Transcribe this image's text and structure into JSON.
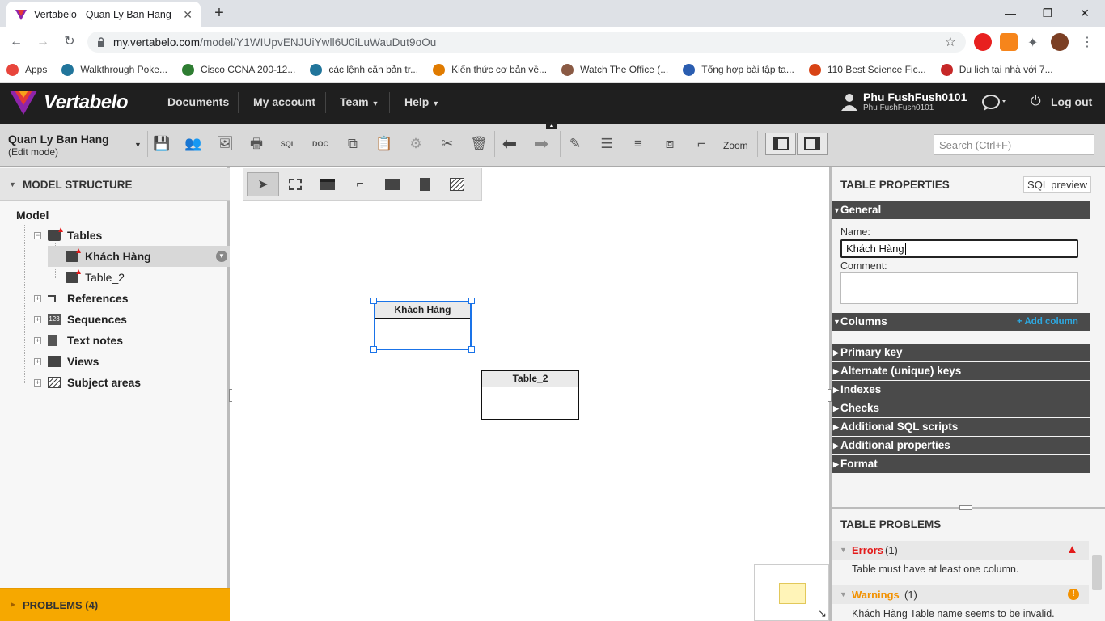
{
  "browser": {
    "tab_title": "Vertabelo - Quan Ly Ban Hang",
    "url_host": "my.vertabelo.com",
    "url_path": "/model/Y1WIUpvENJUiYwll6U0iLuWauDut9oOu",
    "bookmarks": [
      {
        "label": "Apps",
        "color": "#e8453c"
      },
      {
        "label": "Walkthrough Poke...",
        "color": "#21759b"
      },
      {
        "label": "Cisco CCNA 200-12...",
        "color": "#2e7d32"
      },
      {
        "label": "các lệnh căn bản tr...",
        "color": "#21759b"
      },
      {
        "label": "Kiến thức cơ bản về...",
        "color": "#e07b00"
      },
      {
        "label": "Watch The Office (...",
        "color": "#8a5a44"
      },
      {
        "label": "Tổng hợp bài tập ta...",
        "color": "#2a5db0"
      },
      {
        "label": "110 Best Science Fic...",
        "color": "#d84315"
      },
      {
        "label": "Du lịch tại nhà với 7...",
        "color": "#c62828"
      }
    ]
  },
  "app": {
    "logo_text": "Vertabelo",
    "nav": {
      "documents": "Documents",
      "account": "My account",
      "team": "Team",
      "help": "Help"
    },
    "user": {
      "name": "Phu FushFush0101",
      "sub": "Phu FushFush0101"
    },
    "logout": "Log out"
  },
  "toolbar": {
    "model_name": "Quan Ly Ban Hang",
    "mode": "(Edit mode)",
    "zoom_label": "Zoom",
    "search_placeholder": "Search (Ctrl+F)"
  },
  "structure": {
    "header": "MODEL STRUCTURE",
    "root": "Model",
    "tables_label": "Tables",
    "tables": [
      "Khách Hàng",
      "Table_2"
    ],
    "groups": [
      "References",
      "Sequences",
      "Text notes",
      "Views",
      "Subject areas"
    ],
    "problems": "PROBLEMS (4)"
  },
  "canvas": {
    "tables": [
      "Khách Hàng",
      "Table_2"
    ]
  },
  "properties": {
    "header": "TABLE PROPERTIES",
    "sql_preview": "SQL preview",
    "general": "General",
    "name_label": "Name:",
    "name_value": "Khách Hàng",
    "comment_label": "Comment:",
    "columns": "Columns",
    "add_column": "+ Add column",
    "sections": [
      "Primary key",
      "Alternate (unique) keys",
      "Indexes",
      "Checks",
      "Additional SQL scripts",
      "Additional properties",
      "Format"
    ]
  },
  "problems": {
    "header": "TABLE PROBLEMS",
    "errors_label": "Errors",
    "errors_count": "(1)",
    "error_msg": "Table must have at least one column.",
    "warnings_label": "Warnings",
    "warnings_count": "(1)",
    "warning_msg": "Khách Hàng Table name seems to be invalid."
  },
  "colors": {
    "error": "#e31b1b",
    "warning": "#f29100",
    "accent": "#1a73e8",
    "link": "#2da8e0"
  }
}
